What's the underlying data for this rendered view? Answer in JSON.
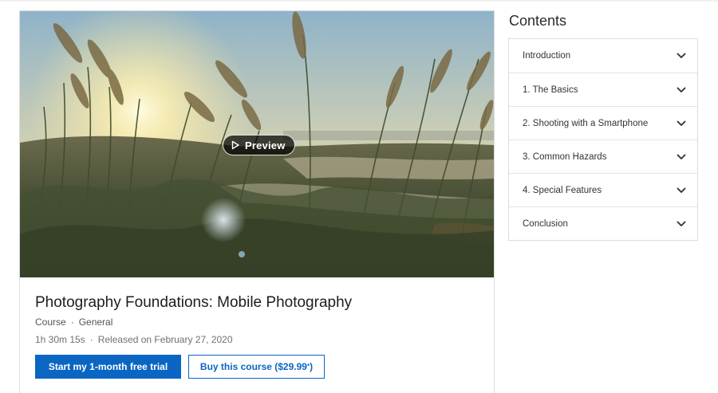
{
  "course": {
    "preview_label": "Preview",
    "title": "Photography Foundations: Mobile Photography",
    "type": "Course",
    "category": "General",
    "separator": "·",
    "duration": "1h 30m 15s",
    "released": "Released on February 27, 2020",
    "primary_button": "Start my 1-month free trial",
    "secondary_button": "Buy this course ($29.99",
    "secondary_button_mark": "*",
    "secondary_button_close": ")"
  },
  "contents": {
    "heading": "Contents",
    "items": [
      {
        "label": "Introduction"
      },
      {
        "label": "1. The Basics"
      },
      {
        "label": "2. Shooting with a Smartphone"
      },
      {
        "label": "3. Common Hazards"
      },
      {
        "label": "4. Special Features"
      },
      {
        "label": "Conclusion"
      }
    ]
  },
  "colors": {
    "accent": "#0a66c2",
    "border": "#dcdcdc",
    "text": "#333333"
  },
  "icons": {
    "preview": "play-icon",
    "expand": "chevron-down-icon"
  }
}
